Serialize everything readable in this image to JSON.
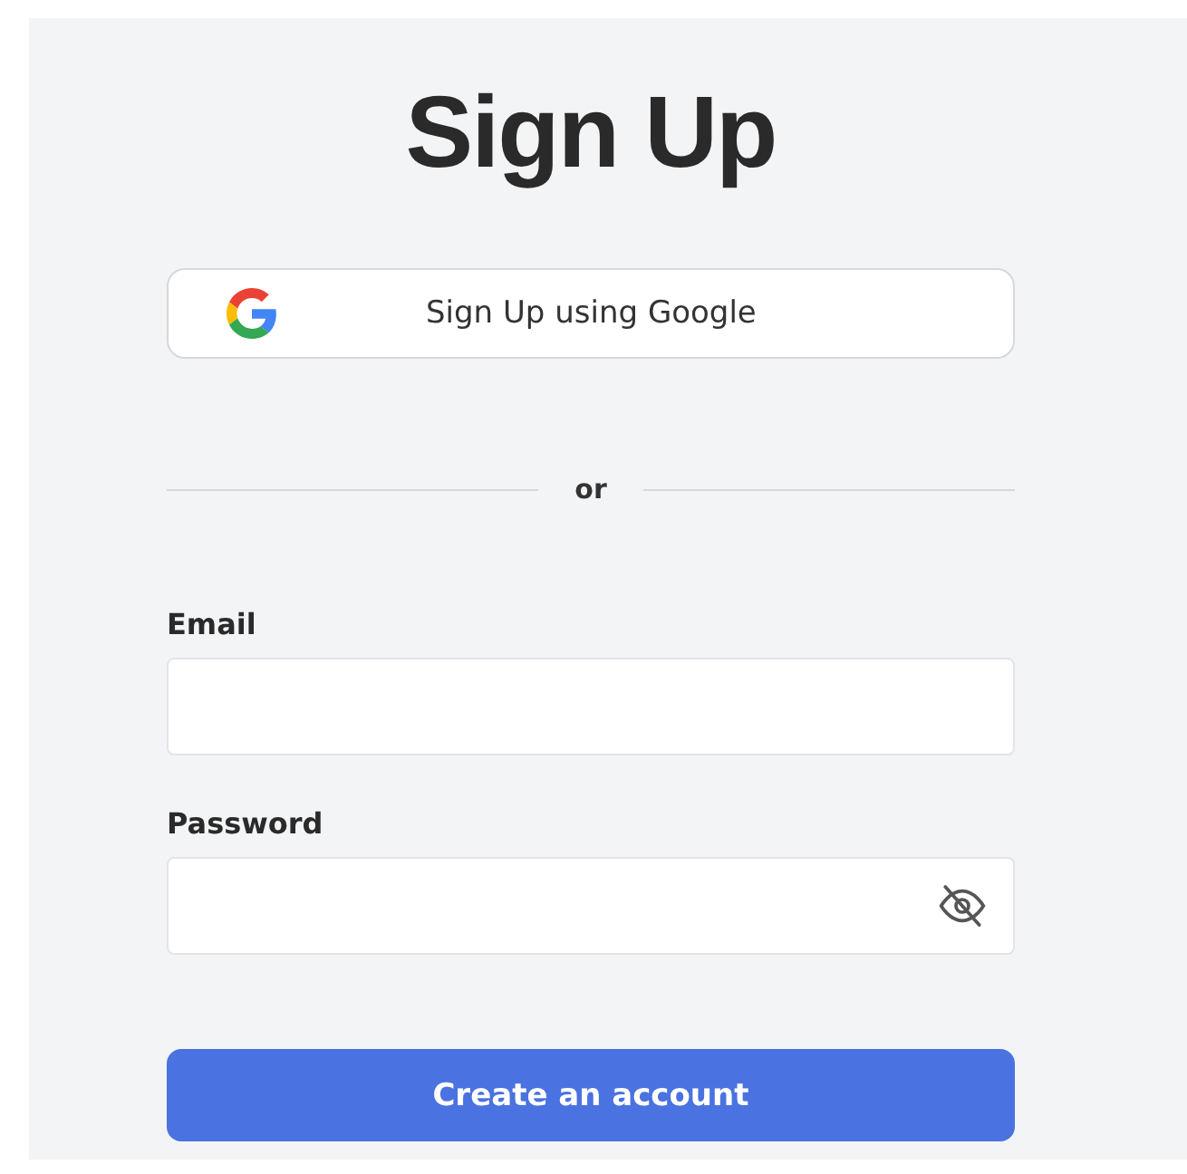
{
  "title": "Sign Up",
  "google_button": {
    "label": "Sign Up using Google"
  },
  "divider": {
    "label": "or"
  },
  "fields": [
    {
      "label": "Email",
      "kind": "text"
    },
    {
      "label": "Password",
      "kind": "password",
      "password_visible": false
    }
  ],
  "submit_button": {
    "label": "Create an account"
  }
}
